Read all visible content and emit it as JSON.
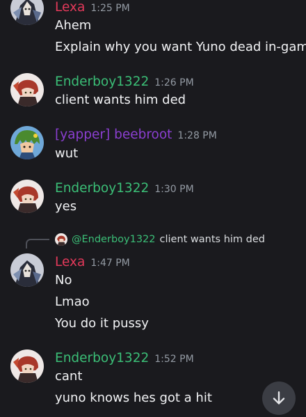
{
  "colors": {
    "background": "#1a1a1e",
    "lexa": "#e3395a",
    "enderboy": "#3bbf77",
    "beebroot": "#8b3fd1",
    "text": "#f2f3f5",
    "timestamp": "#949ba4"
  },
  "messages": [
    {
      "author": "Lexa",
      "time": "1:25 PM",
      "avatar": "lexa-avatar",
      "lines": [
        "Ahem",
        "Explain why you want Yuno dead in-game"
      ]
    },
    {
      "author": "Enderboy1322",
      "time": "1:26 PM",
      "avatar": "enderboy-avatar",
      "lines": [
        "client wants him ded"
      ]
    },
    {
      "author": "[yapper] beebroot",
      "time": "1:28 PM",
      "avatar": "beebroot-avatar",
      "lines": [
        "wut"
      ]
    },
    {
      "author": "Enderboy1322",
      "time": "1:30 PM",
      "avatar": "enderboy-avatar",
      "lines": [
        "yes"
      ]
    },
    {
      "author": "Lexa",
      "time": "1:47 PM",
      "avatar": "lexa-avatar",
      "reply": {
        "mention": "@Enderboy1322",
        "text": "client wants him ded"
      },
      "lines": [
        "No",
        "Lmao",
        "You do it pussy"
      ]
    },
    {
      "author": "Enderboy1322",
      "time": "1:52 PM",
      "avatar": "enderboy-avatar",
      "lines": [
        "cant",
        "yuno knows hes got a hit"
      ]
    }
  ],
  "scroll_button_icon": "arrow-down-icon"
}
